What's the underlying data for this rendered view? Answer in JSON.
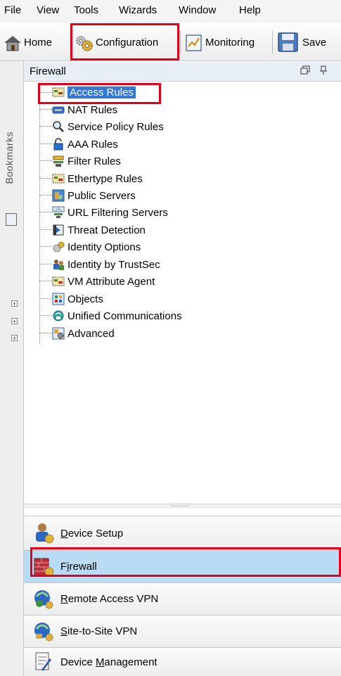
{
  "menubar": {
    "items": [
      "File",
      "View",
      "Tools",
      "Wizards",
      "Window",
      "Help"
    ]
  },
  "toolbar": {
    "home_label": "Home",
    "configuration_label": "Configuration",
    "monitoring_label": "Monitoring",
    "save_label": "Save"
  },
  "sidebar": {
    "bookmarks_label": "Bookmarks"
  },
  "panel": {
    "title": "Firewall"
  },
  "tree": {
    "items": [
      {
        "label": "Access Rules",
        "icon": "access-rules-icon"
      },
      {
        "label": "NAT Rules",
        "icon": "nat-rules-icon"
      },
      {
        "label": "Service Policy Rules",
        "icon": "magnifier-icon"
      },
      {
        "label": "AAA Rules",
        "icon": "padlock-icon"
      },
      {
        "label": "Filter Rules",
        "icon": "filter-rules-icon"
      },
      {
        "label": "Ethertype Rules",
        "icon": "ethertype-rules-icon"
      },
      {
        "label": "Public Servers",
        "icon": "public-servers-icon"
      },
      {
        "label": "URL Filtering Servers",
        "icon": "url-filtering-icon"
      },
      {
        "label": "Threat Detection",
        "icon": "threat-detection-icon"
      },
      {
        "label": "Identity Options",
        "icon": "identity-options-icon"
      },
      {
        "label": "Identity by TrustSec",
        "icon": "trustsec-icon"
      },
      {
        "label": "VM Attribute Agent",
        "icon": "vm-attribute-icon"
      },
      {
        "label": "Objects",
        "icon": "objects-icon"
      },
      {
        "label": "Unified Communications",
        "icon": "unified-communications-icon"
      },
      {
        "label": "Advanced",
        "icon": "advanced-icon"
      }
    ],
    "selected": "Access Rules"
  },
  "nav": {
    "device_setup": {
      "pre": "",
      "mnemonic": "D",
      "post": "evice Setup"
    },
    "firewall": {
      "pre": "F",
      "mnemonic": "i",
      "post": "rewall"
    },
    "remote_access_vpn": {
      "pre": "",
      "mnemonic": "R",
      "post": "emote Access VPN"
    },
    "site_to_site_vpn": {
      "pre": "",
      "mnemonic": "S",
      "post": "ite-to-Site VPN"
    },
    "device_management": {
      "pre": "Device ",
      "mnemonic": "M",
      "post": "anagement"
    },
    "selected": "Firewall"
  },
  "colors": {
    "highlight_red": "#e3001b",
    "selection_blue": "#3377d5",
    "nav_selected": "#b9dbf3"
  }
}
